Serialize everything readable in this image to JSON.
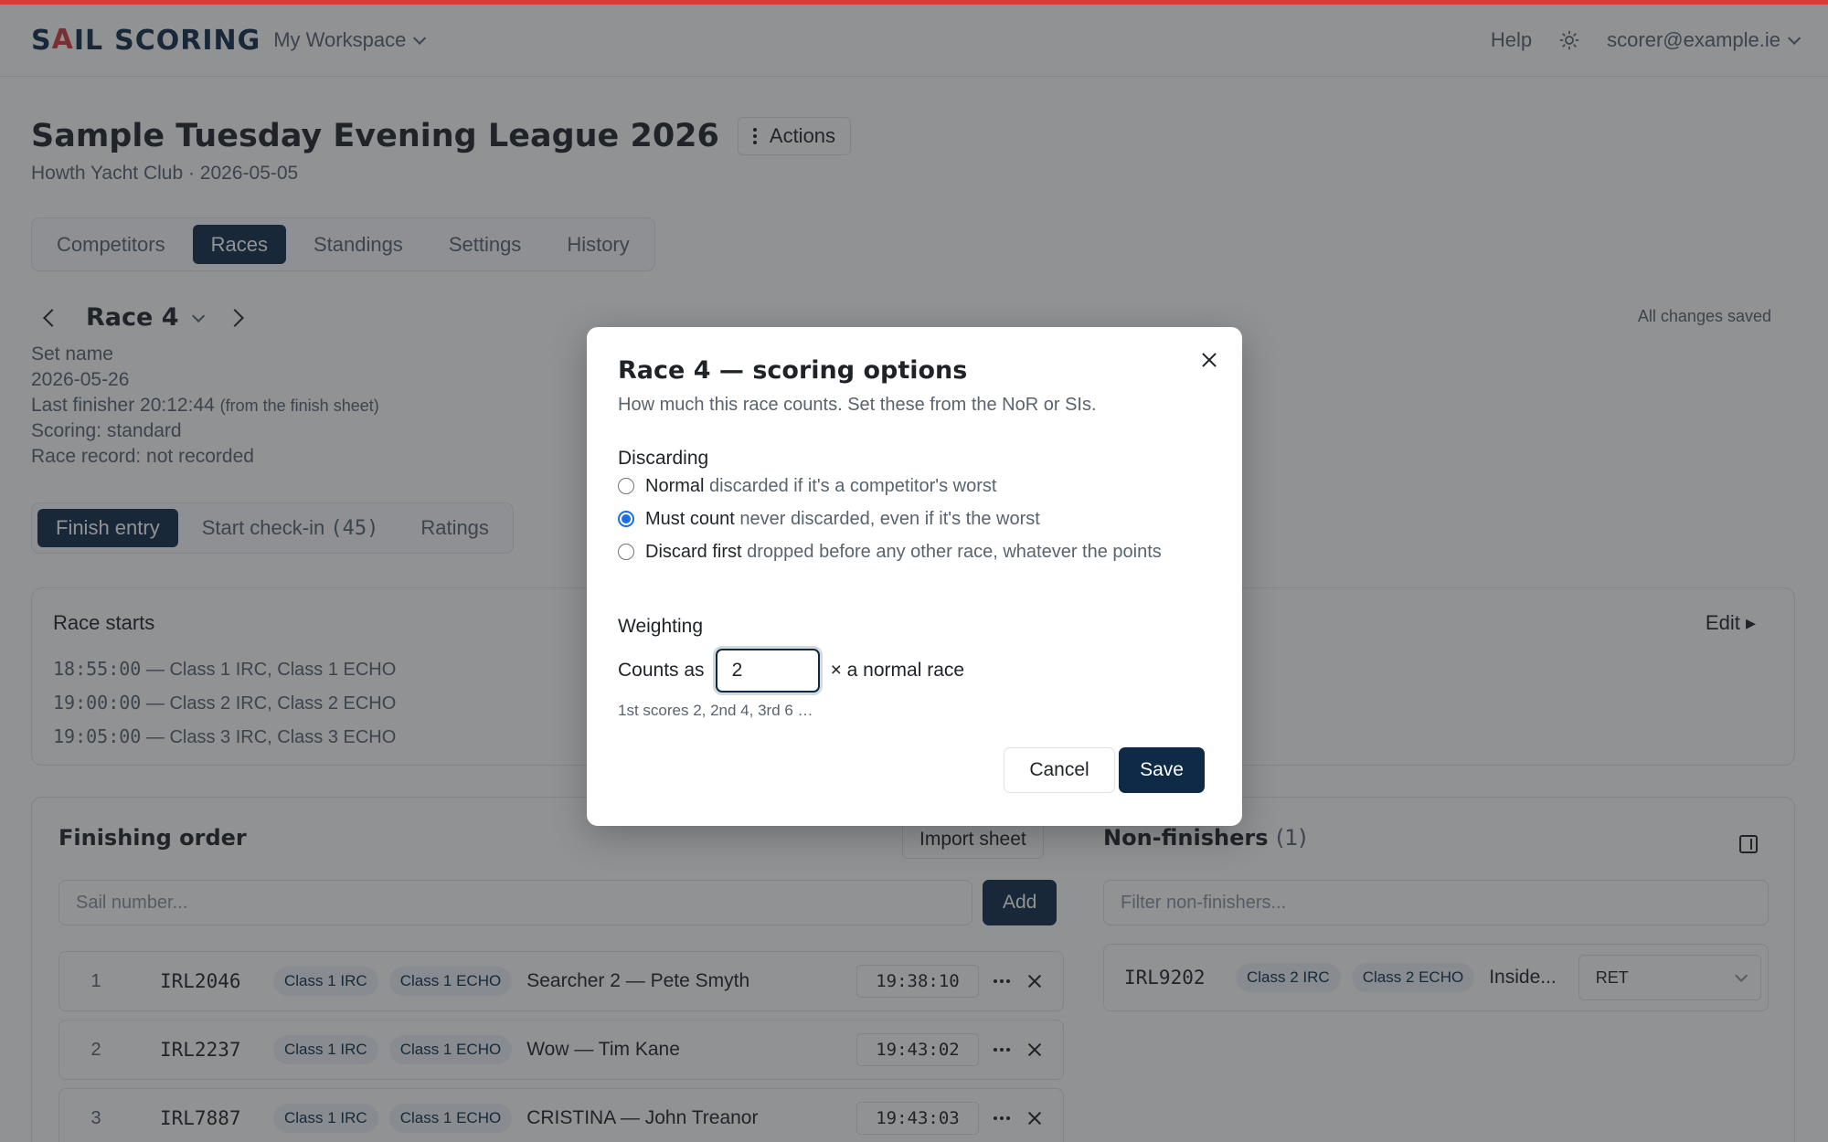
{
  "app": {
    "logo_parts": [
      "S",
      "A",
      "IL",
      "SCORING"
    ],
    "logo_text": "SAIL SCORING",
    "workspace": "My Workspace",
    "help": "Help",
    "user": "scorer@example.ie"
  },
  "event": {
    "title": "Sample Tuesday Evening League 2026",
    "actions_label": "Actions",
    "subtitle": "Howth Yacht Club · 2026-05-05"
  },
  "tabs": [
    {
      "label": "Competitors",
      "active": false
    },
    {
      "label": "Races",
      "active": true
    },
    {
      "label": "Standings",
      "active": false
    },
    {
      "label": "Settings",
      "active": false
    },
    {
      "label": "History",
      "active": false
    }
  ],
  "race": {
    "name": "Race 4",
    "saved_status": "All changes saved",
    "meta": {
      "set_name": "Set name",
      "date": "2026-05-26",
      "last_finisher": "Last finisher 20:12:44",
      "last_finisher_note": "(from the finish sheet)",
      "scoring": "Scoring: standard",
      "record": "Race record: not recorded"
    }
  },
  "subtabs": [
    {
      "label": "Finish entry",
      "active": true
    },
    {
      "label": "Start check-in",
      "count": "(45)",
      "active": false
    },
    {
      "label": "Ratings",
      "active": false
    }
  ],
  "starts": {
    "title": "Race starts",
    "edit_label": "Edit ▸",
    "items": [
      {
        "time": "18:55:00",
        "classes": "— Class 1 IRC, Class 1 ECHO"
      },
      {
        "time": "19:00:00",
        "classes": "— Class 2 IRC, Class 2 ECHO"
      },
      {
        "time": "19:05:00",
        "classes": "— Class 3 IRC, Class 3 ECHO"
      }
    ]
  },
  "finishing": {
    "title": "Finishing order",
    "import_label": "Import sheet",
    "input_placeholder": "Sail number...",
    "add_label": "Add",
    "rows": [
      {
        "pos": "1",
        "sail": "IRL2046",
        "badge1": "Class 1 IRC",
        "badge2": "Class 1 ECHO",
        "boat": "Searcher 2 — Pete Smyth",
        "time": "19:38:10"
      },
      {
        "pos": "2",
        "sail": "IRL2237",
        "badge1": "Class 1 IRC",
        "badge2": "Class 1 ECHO",
        "boat": "Wow — Tim Kane",
        "time": "19:43:02"
      },
      {
        "pos": "3",
        "sail": "IRL7887",
        "badge1": "Class 1 IRC",
        "badge2": "Class 1 ECHO",
        "boat": "CRISTINA — John Treanor",
        "time": "19:43:03"
      }
    ]
  },
  "non_finishers": {
    "title": "Non-finishers",
    "count": "(1)",
    "filter_placeholder": "Filter non-finishers...",
    "rows": [
      {
        "sail": "IRL9202",
        "badge1": "Class 2 IRC",
        "badge2": "Class 2 ECHO",
        "boat": "Inside...",
        "status": "RET"
      }
    ]
  },
  "modal": {
    "title": "Race 4 — scoring options",
    "subtitle": "How much this race counts. Set these from the NoR or SIs.",
    "discarding_label": "Discarding",
    "options": [
      {
        "label": "Normal",
        "desc": "discarded if it's a competitor's worst",
        "checked": false
      },
      {
        "label": "Must count",
        "desc": "never discarded, even if it's the worst",
        "checked": true
      },
      {
        "label": "Discard first",
        "desc": "dropped before any other race, whatever the points",
        "checked": false
      }
    ],
    "weighting_label": "Weighting",
    "counts_as": "Counts as",
    "weight_value": "2",
    "weight_suffix": "× a normal race",
    "hint": "1st scores 2, 2nd 4, 3rd 6 …",
    "cancel_label": "Cancel",
    "save_label": "Save"
  }
}
